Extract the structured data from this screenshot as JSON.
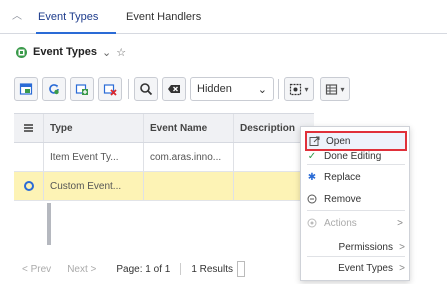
{
  "tabs": [
    {
      "label": "Event Types",
      "active": true
    },
    {
      "label": "Event Handlers",
      "active": false
    }
  ],
  "header": {
    "title": "Event Types",
    "title_icon": "item-type-icon",
    "chevron": "⌄",
    "star": "☆"
  },
  "toolbar": {
    "buttons": [
      "new-item-icon",
      "refresh-icon",
      "add-icon",
      "delete-icon",
      "search-icon",
      "clear-icon"
    ],
    "select_value": "Hidden",
    "select_chevron": "⌄"
  },
  "grid": {
    "columns": [
      "Type",
      "Event Name",
      "Description"
    ],
    "rows": [
      {
        "type": "Item Event Ty...",
        "event_name": "com.aras.inno...",
        "description": "",
        "selected": false
      },
      {
        "type": "Custom Event...",
        "event_name": "",
        "description": "",
        "selected": true
      }
    ]
  },
  "pager": {
    "prev": "< Prev",
    "next": "Next >",
    "page": "Page: 1 of 1",
    "results": "1 Results"
  },
  "context_menu": {
    "items": [
      {
        "label": "Open",
        "icon": "open-icon",
        "highlighted": true
      },
      {
        "label": "Done Editing",
        "icon": "check-icon"
      },
      {
        "label": "Replace",
        "icon": "replace-icon"
      },
      {
        "label": "Remove",
        "icon": "remove-icon"
      },
      {
        "label": "Actions",
        "icon": "actions-icon",
        "disabled": true,
        "submenu": true
      },
      {
        "label": "Permissions",
        "submenu": true
      },
      {
        "label": "Event Types",
        "submenu": true
      }
    ],
    "submenu_arrow": ">"
  },
  "colors": {
    "accent": "#2a6bd6",
    "selected_row": "#fdf3b5",
    "highlight_border": "#e0303a",
    "check": "#2e9b4b"
  }
}
